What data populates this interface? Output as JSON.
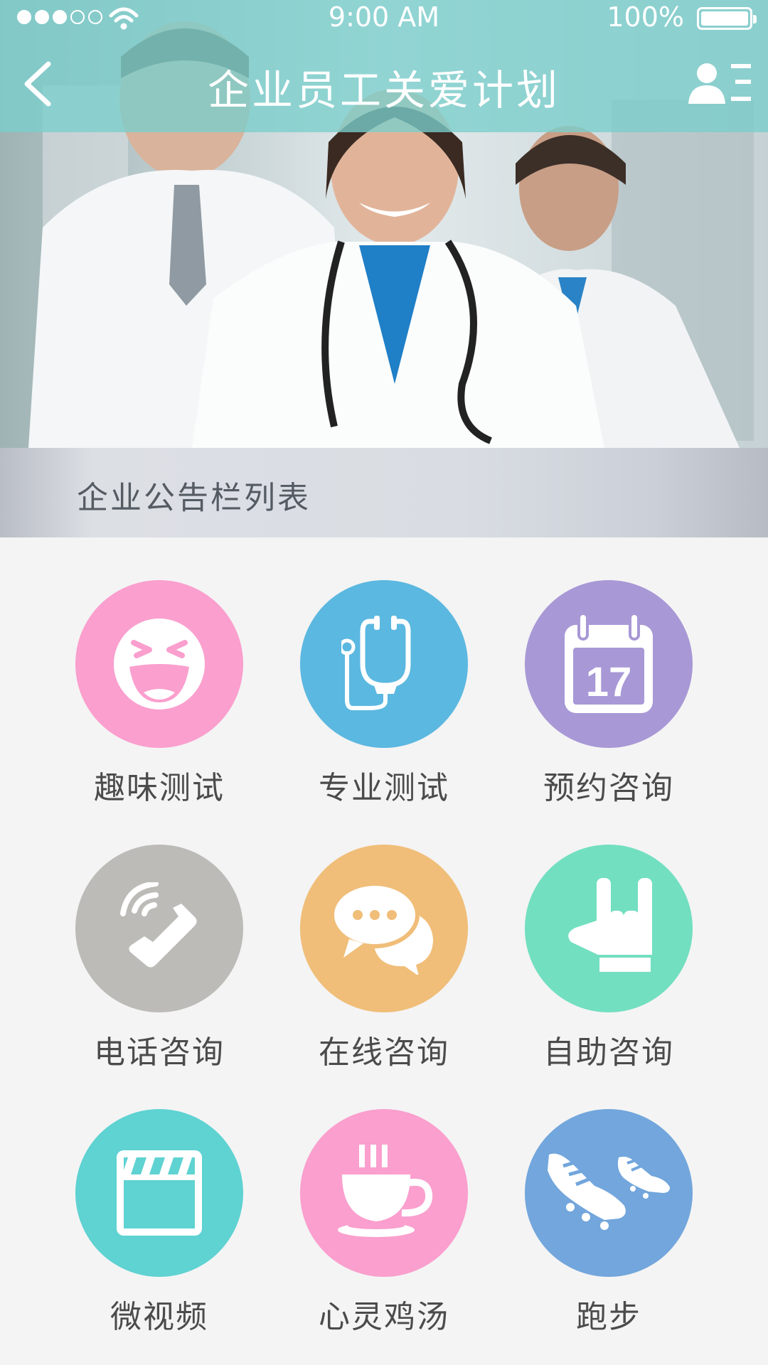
{
  "status_bar": {
    "time": "9:00 AM",
    "battery": "100%"
  },
  "header": {
    "title": "企业员工关爱计划",
    "back_icon": "chevron-left-icon",
    "profile_icon": "user-list-icon"
  },
  "banner": {
    "notice_label": "企业公告栏列表"
  },
  "menu": [
    {
      "label": "趣味测试",
      "icon": "laughing-face-icon",
      "color": "#fa9fce"
    },
    {
      "label": "专业测试",
      "icon": "stethoscope-icon",
      "color": "#5bb8e0"
    },
    {
      "label": "预约咨询",
      "icon": "calendar-icon",
      "color": "#a898d6",
      "icon_text": "17"
    },
    {
      "label": "电话咨询",
      "icon": "phone-icon",
      "color": "#bcbbb8"
    },
    {
      "label": "在线咨询",
      "icon": "chat-bubbles-icon",
      "color": "#f0be79"
    },
    {
      "label": "自助咨询",
      "icon": "hand-gesture-icon",
      "color": "#72dfc0"
    },
    {
      "label": "微视频",
      "icon": "clapperboard-icon",
      "color": "#5fd2d2"
    },
    {
      "label": "心灵鸡汤",
      "icon": "coffee-cup-icon",
      "color": "#fa9fce"
    },
    {
      "label": "跑步",
      "icon": "running-shoes-icon",
      "color": "#72a6dc"
    }
  ]
}
